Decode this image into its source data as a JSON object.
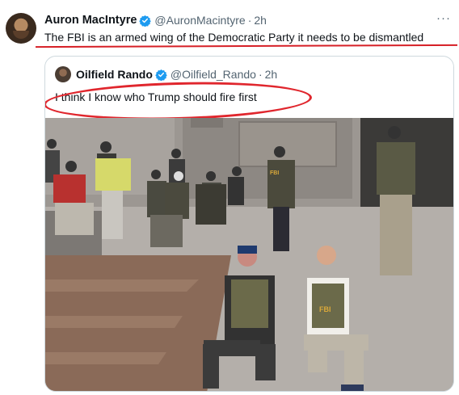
{
  "tweet": {
    "author_name": "Auron MacIntyre",
    "author_handle": "@AuronMacintyre",
    "separator": "·",
    "time": "2h",
    "more": "···",
    "text": "The FBI is an armed wing of the Democratic Party it needs to be dismantled"
  },
  "quoted_tweet": {
    "author_name": "Oilfield Rando",
    "author_handle": "@Oilfield_Rando",
    "separator": "·",
    "time": "2h",
    "text": "I think I know who Trump should fire first",
    "photo_vest_label": "FBI"
  },
  "colors": {
    "verified_blue": "#1d9bf0",
    "annotation_red": "#d61f26",
    "vest_olive": "#6b6a4a"
  },
  "icons": {
    "verified": "verified-badge-icon",
    "more": "more-options-icon"
  }
}
